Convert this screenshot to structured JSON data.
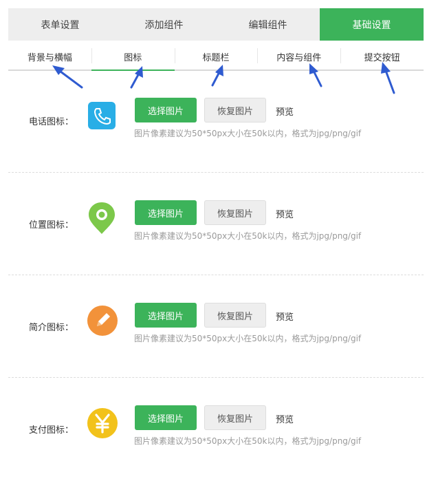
{
  "top_tabs": [
    {
      "label": "表单设置"
    },
    {
      "label": "添加组件"
    },
    {
      "label": "编辑组件"
    },
    {
      "label": "基础设置"
    }
  ],
  "sub_tabs": [
    {
      "label": "背景与横幅"
    },
    {
      "label": "图标"
    },
    {
      "label": "标题栏"
    },
    {
      "label": "内容与组件"
    },
    {
      "label": "提交按钮"
    }
  ],
  "rows": [
    {
      "label": "电话图标：",
      "icon": "phone-icon",
      "icon_color": "#29aee6",
      "select_label": "选择图片",
      "reset_label": "恢复图片",
      "preview_label": "预览",
      "hint": "图片像素建议为50*50px大小在50k以内，格式为jpg/png/gif"
    },
    {
      "label": "位置图标：",
      "icon": "location-pin-icon",
      "icon_color": "#7cc84a",
      "select_label": "选择图片",
      "reset_label": "恢复图片",
      "preview_label": "预览",
      "hint": "图片像素建议为50*50px大小在50k以内，格式为jpg/png/gif"
    },
    {
      "label": "简介图标：",
      "icon": "pencil-icon",
      "icon_color": "#f2923a",
      "select_label": "选择图片",
      "reset_label": "恢复图片",
      "preview_label": "预览",
      "hint": "图片像素建议为50*50px大小在50k以内，格式为jpg/png/gif"
    },
    {
      "label": "支付图标：",
      "icon": "yen-icon",
      "icon_color": "#f2c21b",
      "select_label": "选择图片",
      "reset_label": "恢复图片",
      "preview_label": "预览",
      "hint": "图片像素建议为50*50px大小在50k以内，格式为jpg/png/gif"
    }
  ],
  "colors": {
    "accent": "#3cb35a",
    "annotation_arrow": "#2f5bd0"
  }
}
